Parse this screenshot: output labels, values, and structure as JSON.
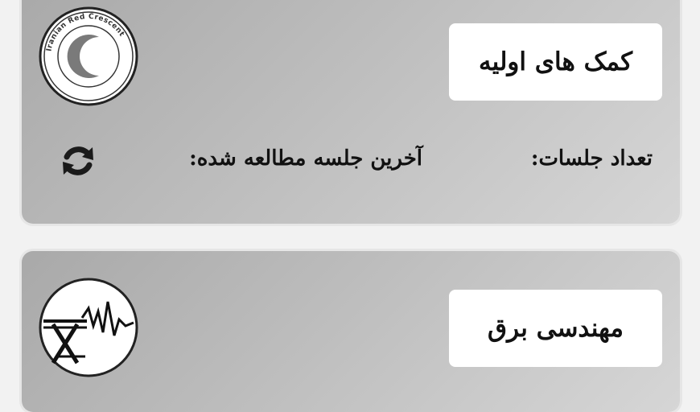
{
  "courses": [
    {
      "title": "کمک های اولیه",
      "logo_icon": "red-crescent-logo-icon",
      "logo_text": "Iranian Red Crescent",
      "sessions_label": "تعداد جلسات:",
      "last_session_label": "آخرین جلسه مطالعه شده:",
      "refresh_icon": "refresh-icon"
    },
    {
      "title": "مهندسی برق",
      "logo_icon": "electrical-engineering-logo-icon"
    }
  ],
  "colors": {
    "page_background": "#f2f2f2",
    "card_gradient_start": "#a9a9a9",
    "card_gradient_end": "#d6d6d6",
    "title_box": "#ffffff",
    "text": "#111111"
  }
}
